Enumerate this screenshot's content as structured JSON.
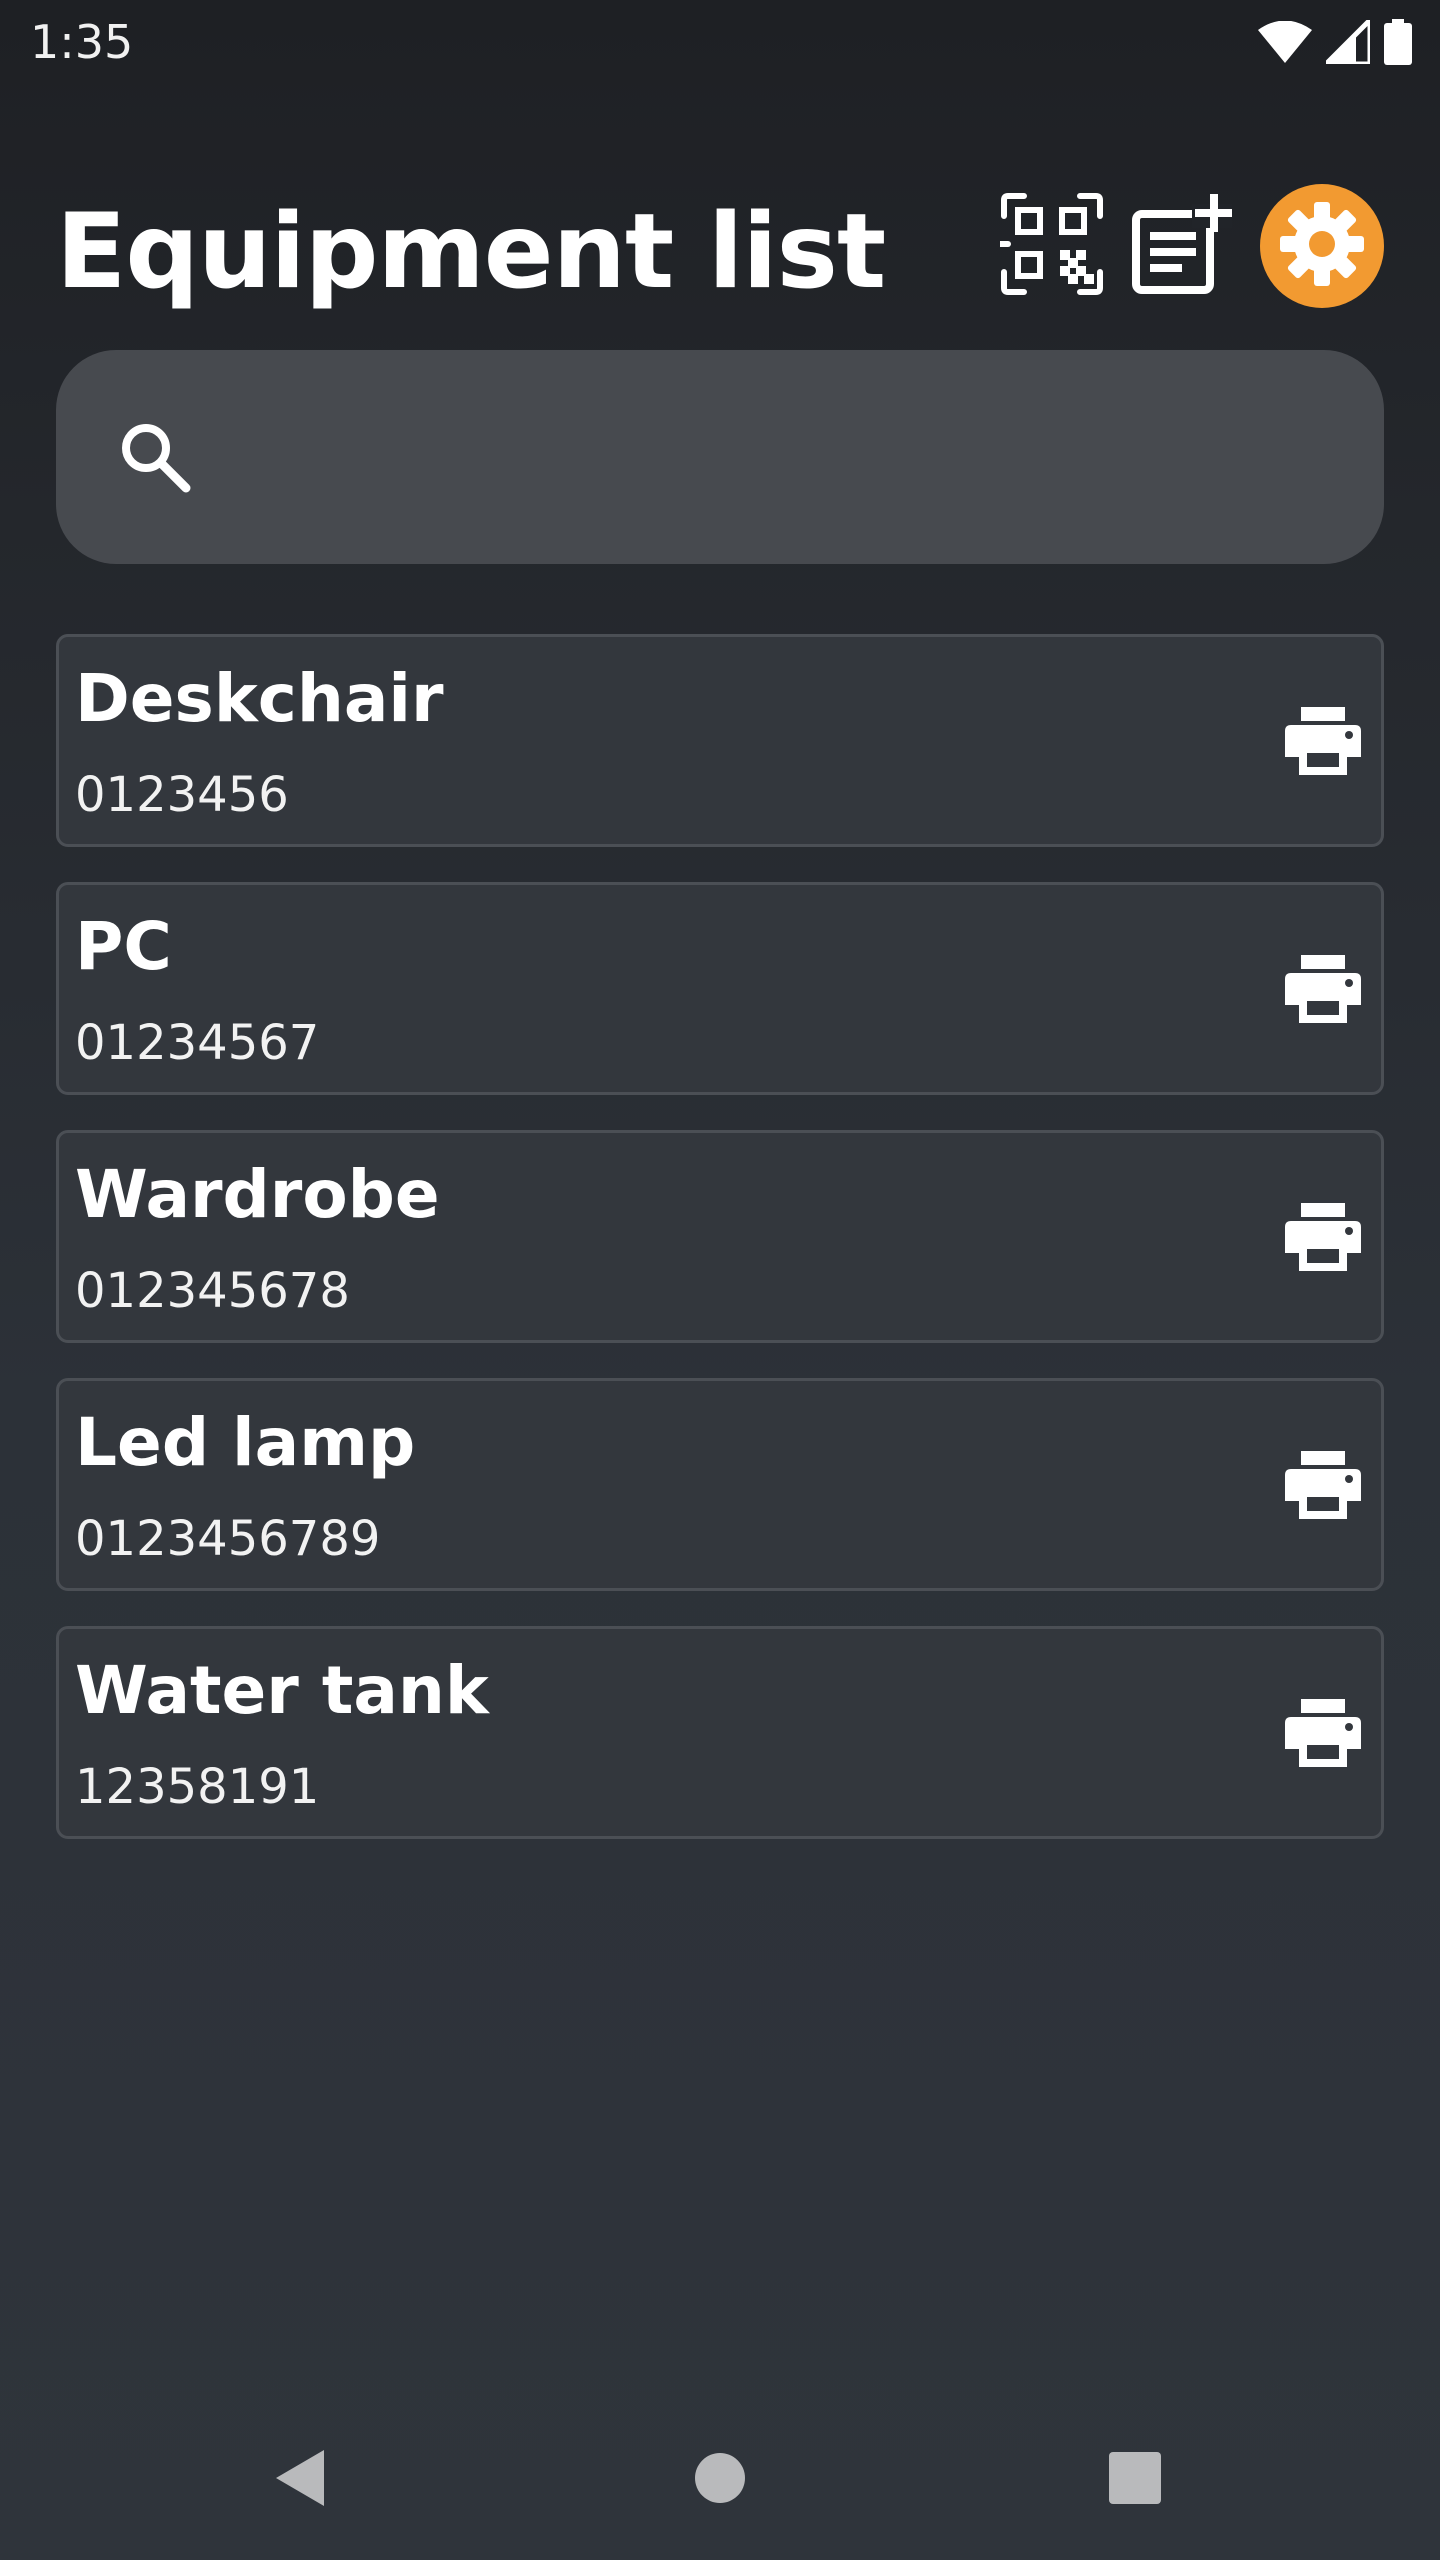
{
  "status_bar": {
    "time": "1:35",
    "icons": [
      "wifi-icon",
      "signal-icon",
      "battery-icon"
    ]
  },
  "header": {
    "title": "Equipment list",
    "actions": [
      "qr-code-scan-icon",
      "add-note-icon",
      "gear-icon"
    ]
  },
  "search": {
    "placeholder": "",
    "value": ""
  },
  "items": [
    {
      "name": "Deskchair",
      "code": "0123456"
    },
    {
      "name": "PC",
      "code": "01234567"
    },
    {
      "name": "Wardrobe",
      "code": "012345678"
    },
    {
      "name": "Led lamp",
      "code": "0123456789"
    },
    {
      "name": "Water tank",
      "code": "12358191"
    }
  ],
  "nav": [
    "back-icon",
    "home-icon",
    "recents-icon"
  ],
  "colors": {
    "accent": "#f29a31",
    "background": "#2c3138",
    "card": "#33373d",
    "search_field": "#474a4f"
  }
}
